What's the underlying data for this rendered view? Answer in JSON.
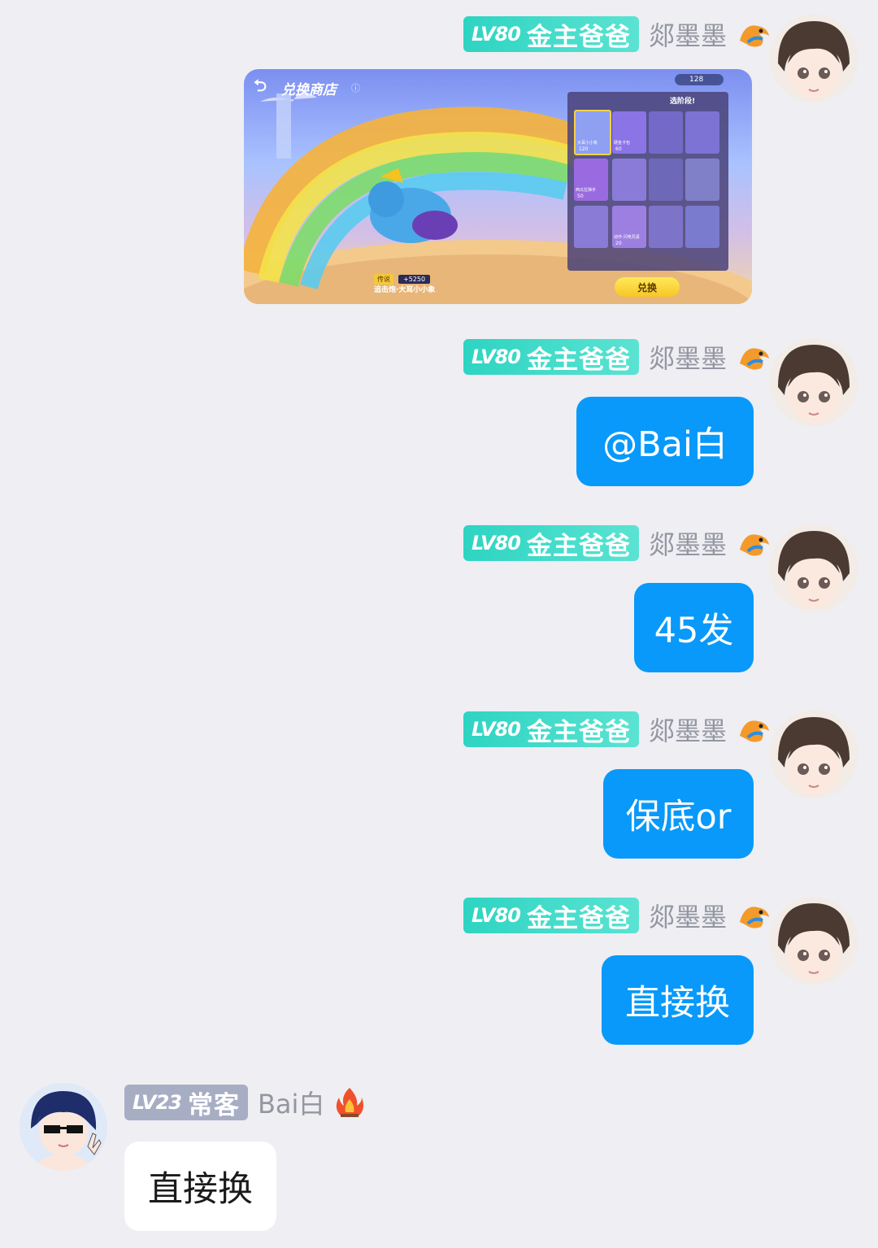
{
  "colors": {
    "background": "#EEEEF3",
    "my_bubble": "#0899FA",
    "their_bubble": "#FFFFFF",
    "badge_gold": "#2ED4C2",
    "badge_grey": "#A7AEC4",
    "nickname": "#9497A0"
  },
  "messages": [
    {
      "side": "right",
      "level": "LV80",
      "title": "金主爸爸",
      "nickname": "郯墨墨",
      "decor_icon": "dragon-icon",
      "type": "image",
      "image": {
        "screen_title": "兑换商店",
        "currency": "128",
        "tab_label": "选阶段!",
        "rarity": "传说",
        "price": "5250",
        "item_name": "追击炮·大耳小小象",
        "button": "兑换",
        "tiles": [
          {
            "label": "大耳小小象",
            "price": "120"
          },
          {
            "label": "硬金卡包",
            "price": "60"
          },
          {
            "label": "",
            "price": ""
          },
          {
            "label": "",
            "price": ""
          },
          {
            "label": "西瓜拉弹手",
            "price": "50"
          },
          {
            "label": "",
            "price": ""
          },
          {
            "label": "",
            "price": ""
          },
          {
            "label": "",
            "price": ""
          },
          {
            "label": "",
            "price": ""
          },
          {
            "label": "动作·闪电咒语",
            "price": "20"
          },
          {
            "label": "",
            "price": ""
          },
          {
            "label": "",
            "price": ""
          }
        ]
      }
    },
    {
      "side": "right",
      "level": "LV80",
      "title": "金主爸爸",
      "nickname": "郯墨墨",
      "decor_icon": "dragon-icon",
      "type": "text",
      "text": "@Bai白"
    },
    {
      "side": "right",
      "level": "LV80",
      "title": "金主爸爸",
      "nickname": "郯墨墨",
      "decor_icon": "dragon-icon",
      "type": "text",
      "text": "45发"
    },
    {
      "side": "right",
      "level": "LV80",
      "title": "金主爸爸",
      "nickname": "郯墨墨",
      "decor_icon": "dragon-icon",
      "type": "text",
      "text": "保底or"
    },
    {
      "side": "right",
      "level": "LV80",
      "title": "金主爸爸",
      "nickname": "郯墨墨",
      "decor_icon": "dragon-icon",
      "type": "text",
      "text": "直接换"
    },
    {
      "side": "left",
      "level": "LV23",
      "title": "常客",
      "nickname": "Bai白",
      "decor_icon": "fire-icon",
      "type": "text",
      "text": "直接换"
    }
  ]
}
